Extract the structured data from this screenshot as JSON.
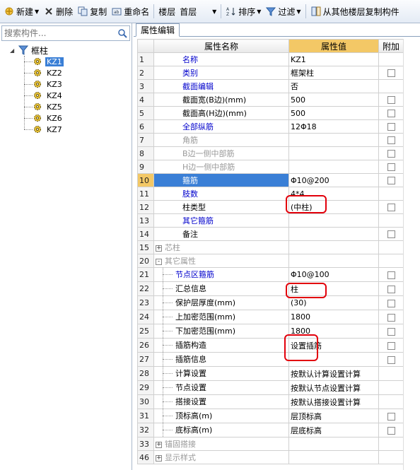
{
  "toolbar": {
    "new_label": "新建",
    "delete_label": "删除",
    "copy_label": "复制",
    "rename_label": "重命名",
    "floor_label": "楼层",
    "floor_value": "首层",
    "sort_label": "排序",
    "filter_label": "过滤",
    "copy_from_floor_label": "从其他楼层复制构件"
  },
  "search": {
    "placeholder": "搜索构件..."
  },
  "tree": {
    "root_label": "框柱",
    "items": [
      "KZ1",
      "KZ2",
      "KZ3",
      "KZ4",
      "KZ5",
      "KZ6",
      "KZ7"
    ],
    "selected": "KZ1"
  },
  "tab": {
    "label": "属性编辑"
  },
  "grid": {
    "headers": {
      "name": "属性名称",
      "value": "属性值",
      "add": "附加"
    },
    "rows": [
      {
        "num": "1",
        "name": "名称",
        "value": "KZ1",
        "color": "blue",
        "check": false
      },
      {
        "num": "2",
        "name": "类别",
        "value": "框架柱",
        "color": "blue",
        "check": true
      },
      {
        "num": "3",
        "name": "截面编辑",
        "value": "否",
        "color": "blue",
        "check": false
      },
      {
        "num": "4",
        "name": "截面宽(B边)(mm)",
        "value": "500",
        "color": "black",
        "check": true
      },
      {
        "num": "5",
        "name": "截面高(H边)(mm)",
        "value": "500",
        "color": "black",
        "check": true
      },
      {
        "num": "6",
        "name": "全部纵筋",
        "value": "12Φ18",
        "color": "blue",
        "check": true
      },
      {
        "num": "7",
        "name": "角筋",
        "value": "",
        "color": "gray",
        "check": true
      },
      {
        "num": "8",
        "name": "B边一侧中部筋",
        "value": "",
        "color": "gray",
        "check": true
      },
      {
        "num": "9",
        "name": "H边一侧中部筋",
        "value": "",
        "color": "gray",
        "check": true
      },
      {
        "num": "10",
        "name": "箍筋",
        "value": "Φ10@200",
        "color": "blue",
        "check": true,
        "highlight": true
      },
      {
        "num": "11",
        "name": "肢数",
        "value": "4*4",
        "color": "blue",
        "check": false
      },
      {
        "num": "12",
        "name": "柱类型",
        "value": "(中柱)",
        "color": "black",
        "check": true
      },
      {
        "num": "13",
        "name": "其它箍筋",
        "value": "",
        "color": "blue",
        "check": false
      },
      {
        "num": "14",
        "name": "备注",
        "value": "",
        "color": "black",
        "check": true
      },
      {
        "num": "15",
        "name": "芯柱",
        "value": "",
        "color": "gray",
        "group": "+",
        "check": false
      },
      {
        "num": "20",
        "name": "其它属性",
        "value": "",
        "color": "gray",
        "group": "-",
        "check": false
      },
      {
        "num": "21",
        "name": "节点区箍筋",
        "value": "Φ10@100",
        "color": "blue",
        "child": true,
        "check": true
      },
      {
        "num": "22",
        "name": "汇总信息",
        "value": "柱",
        "color": "black",
        "child": true,
        "check": true
      },
      {
        "num": "23",
        "name": "保护层厚度(mm)",
        "value": "(30)",
        "color": "black",
        "child": true,
        "check": true
      },
      {
        "num": "24",
        "name": "上加密范围(mm)",
        "value": "1800",
        "color": "black",
        "child": true,
        "check": true
      },
      {
        "num": "25",
        "name": "下加密范围(mm)",
        "value": "1800",
        "color": "black",
        "child": true,
        "check": true
      },
      {
        "num": "26",
        "name": "插筋构造",
        "value": "设置插筋",
        "color": "black",
        "child": true,
        "check": true
      },
      {
        "num": "27",
        "name": "插筋信息",
        "value": "",
        "color": "black",
        "child": true,
        "check": true
      },
      {
        "num": "28",
        "name": "计算设置",
        "value": "按默认计算设置计算",
        "color": "black",
        "child": true,
        "check": false
      },
      {
        "num": "29",
        "name": "节点设置",
        "value": "按默认节点设置计算",
        "color": "black",
        "child": true,
        "check": false
      },
      {
        "num": "30",
        "name": "搭接设置",
        "value": "按默认搭接设置计算",
        "color": "black",
        "child": true,
        "check": false
      },
      {
        "num": "31",
        "name": "顶标高(m)",
        "value": "层顶标高",
        "color": "black",
        "child": true,
        "check": true
      },
      {
        "num": "32",
        "name": "底标高(m)",
        "value": "层底标高",
        "color": "black",
        "child": true,
        "check": true
      },
      {
        "num": "33",
        "name": "锚固搭接",
        "value": "",
        "color": "gray",
        "group": "+",
        "check": false
      },
      {
        "num": "46",
        "name": "显示样式",
        "value": "",
        "color": "gray",
        "group": "+",
        "check": false
      }
    ]
  },
  "colors": {
    "highlight_header": "#f3c866",
    "selection": "#3a7fd6",
    "annotation": "#e2000b"
  }
}
